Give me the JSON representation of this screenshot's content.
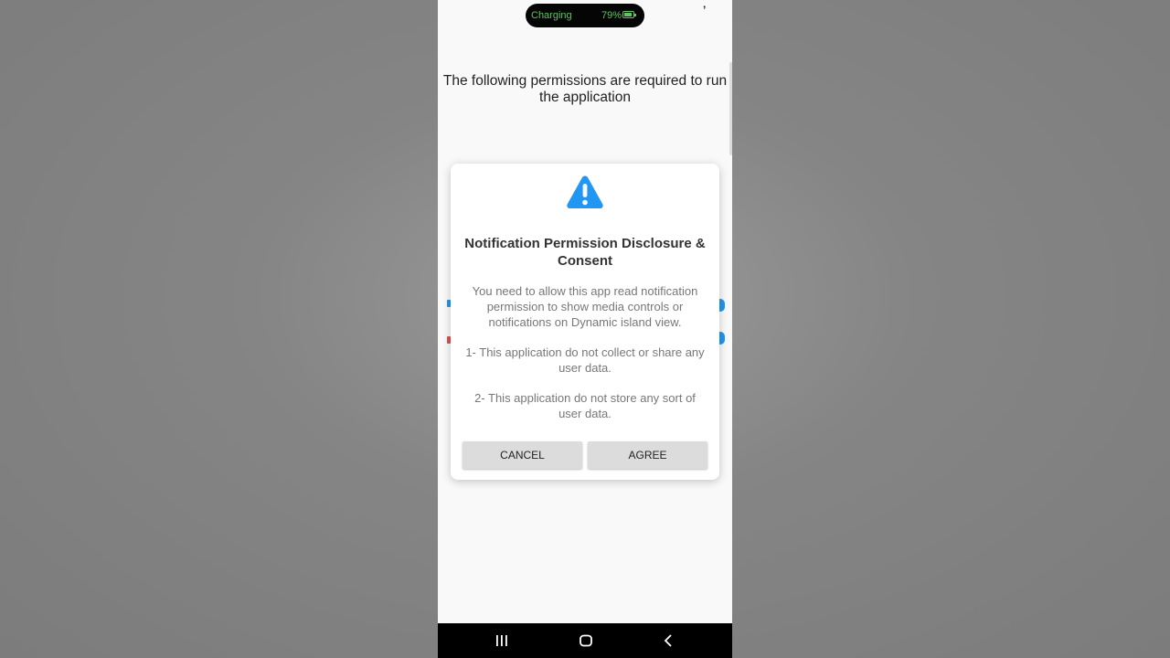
{
  "status_bar": {
    "charging_label": "Charging",
    "battery_percent": "79%",
    "status_glyph": "’"
  },
  "screen": {
    "heading": "The following permissions are required to run the application"
  },
  "dialog": {
    "icon": "warning-triangle-icon",
    "title": "Notification Permission Disclosure & Consent",
    "body_paragraphs": [
      "You need to allow this app read notification permission to show media controls or notifications on Dynamic island view.",
      "1- This application do not collect or share any user data.",
      "2- This application do not store any sort of user data."
    ],
    "cancel_label": "CANCEL",
    "agree_label": "AGREE"
  },
  "navigation_bar": {
    "recents": "recents-icon",
    "home": "home-icon",
    "back": "back-icon"
  },
  "colors": {
    "accent_blue": "#2196f3",
    "charging_green": "#5cc55c",
    "button_gray": "#dcdcdc",
    "nav_black": "#000000"
  }
}
